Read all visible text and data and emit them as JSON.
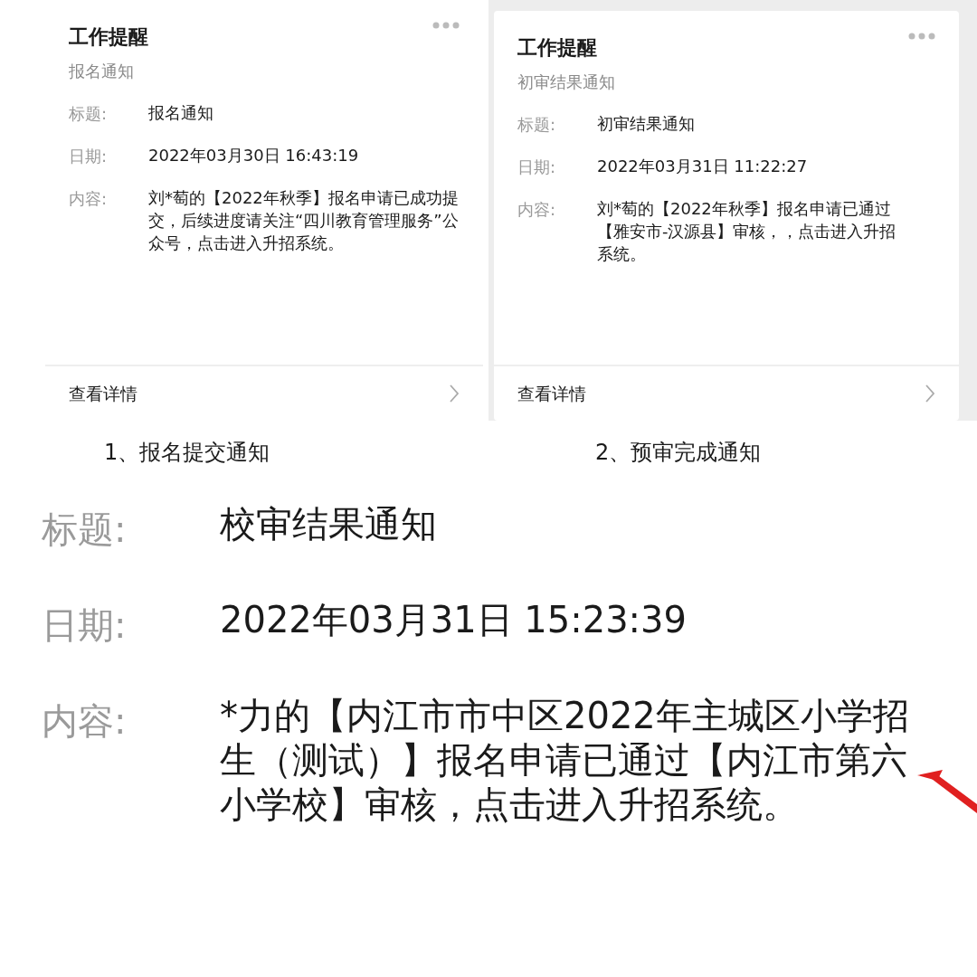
{
  "cards": [
    {
      "header": "工作提醒",
      "subtitle": "报名通知",
      "fields": [
        {
          "label": "标题:",
          "value": "报名通知"
        },
        {
          "label": "日期:",
          "value": "2022年03月30日 16:43:19"
        },
        {
          "label": "内容:",
          "value": "刘*萄的【2022年秋季】报名申请已成功提交，后续进度请关注“四川教育管理服务”公众号，点击进入升招系统。"
        }
      ],
      "link": "查看详情",
      "caption": "1、报名提交通知"
    },
    {
      "header": "工作提醒",
      "subtitle": "初审结果通知",
      "fields": [
        {
          "label": "标题:",
          "value": "初审结果通知"
        },
        {
          "label": "日期:",
          "value": "2022年03月31日 11:22:27"
        },
        {
          "label": "内容:",
          "value": "刘*萄的【2022年秋季】报名申请已通过【雅安市-汉源县】审核，，点击进入升招系统。"
        }
      ],
      "link": "查看详情",
      "caption": "2、预审完成通知"
    }
  ],
  "detail": {
    "fields": [
      {
        "label": "标题:",
        "value": "校审结果通知"
      },
      {
        "label": "日期:",
        "value": "2022年03月31日 15:23:39"
      },
      {
        "label": "内容:",
        "value": "*力的【内江市市中区2022年主城区小学招生（测试）】报名申请已通过【内江市第六小学校】审核，点击进入升招系统。"
      }
    ]
  }
}
